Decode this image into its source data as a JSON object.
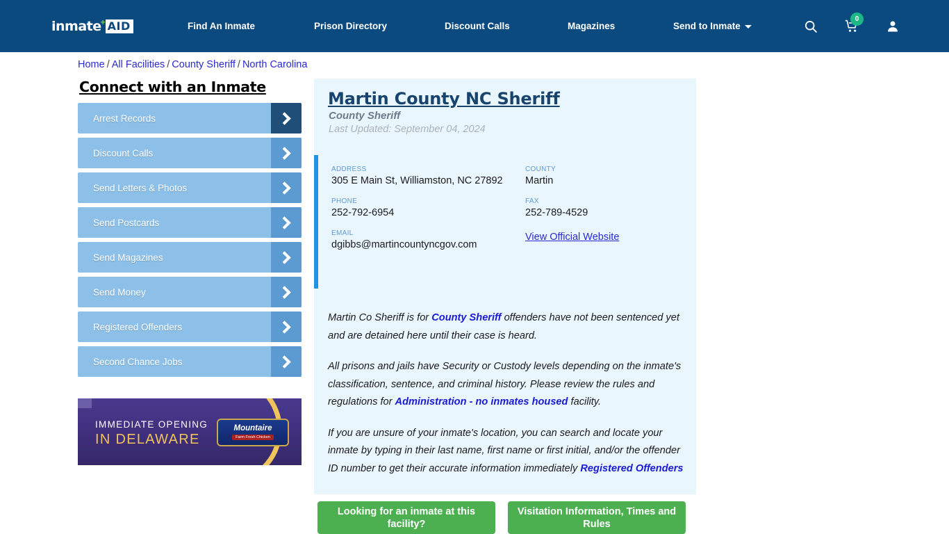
{
  "header": {
    "logo": {
      "word": "inmate",
      "plus": "+",
      "aid": "AID"
    },
    "nav": [
      {
        "label": "Find An Inmate"
      },
      {
        "label": "Prison Directory"
      },
      {
        "label": "Discount Calls"
      },
      {
        "label": "Magazines"
      },
      {
        "label": "Send to Inmate"
      }
    ],
    "icons": {
      "search": "search-icon",
      "cart": "cart-icon",
      "cart_badge": "0",
      "account": "user-icon"
    },
    "bg_color": "#0b4a7f",
    "badge_color": "#1db887"
  },
  "breadcrumb": {
    "items": [
      "Home",
      "All Facilities",
      "County Sheriff",
      "North Carolina"
    ],
    "separator": "/"
  },
  "sidebar": {
    "title": "Connect with an Inmate",
    "items": [
      {
        "label": "Arrest Records",
        "active": true
      },
      {
        "label": "Discount Calls",
        "active": false
      },
      {
        "label": "Send Letters & Photos",
        "active": false
      },
      {
        "label": "Send Postcards",
        "active": false
      },
      {
        "label": "Send Magazines",
        "active": false
      },
      {
        "label": "Send Money",
        "active": false
      },
      {
        "label": "Registered Offenders",
        "active": false
      },
      {
        "label": "Second Chance Jobs",
        "active": false
      }
    ]
  },
  "ad": {
    "line1": "IMMEDIATE OPENING",
    "line2": "IN DELAWARE",
    "logo_main": "Mountaire",
    "logo_sub": "Farm Fresh Chicken"
  },
  "facility": {
    "title": "Martin County NC Sheriff",
    "type": "County Sheriff",
    "last_updated": "Last Updated: September 04, 2024",
    "fields": {
      "address_label": "ADDRESS",
      "address_value": "305 E Main St, Williamston, NC 27892",
      "county_label": "COUNTY",
      "county_value": "Martin",
      "phone_label": "PHONE",
      "phone_value": "252-792-6954",
      "fax_label": "FAX",
      "fax_value": "252-789-4529",
      "email_label": "EMAIL",
      "email_value": "dgibbs@martincountyncgov.com",
      "website_link": "View Official Website"
    },
    "accent_color": "#1f93e8",
    "card_bg": "#eaf6fd"
  },
  "body": {
    "p1_a": "Martin Co Sheriff is for ",
    "p1_link": "County Sheriff",
    "p1_b": " offenders have not been sentenced yet and are detained here until their case is heard.",
    "p2_a": "All prisons and jails have Security or Custody levels depending on the inmate's classification, sentence, and criminal history. Please review the rules and regulations for ",
    "p2_link": "Administration - no inmates housed",
    "p2_b": " facility.",
    "p3_a": "If you are unsure of your inmate's location, you can search and locate your inmate by typing in their last name, first name or first initial, and/or the offender ID number to get their accurate information immediately ",
    "p3_link": "Registered Offenders"
  },
  "buttons": {
    "find_inmate": "Looking for an inmate at this facility?",
    "visitation": "Visitation Information, Times and Rules",
    "color": "#4caf50"
  }
}
